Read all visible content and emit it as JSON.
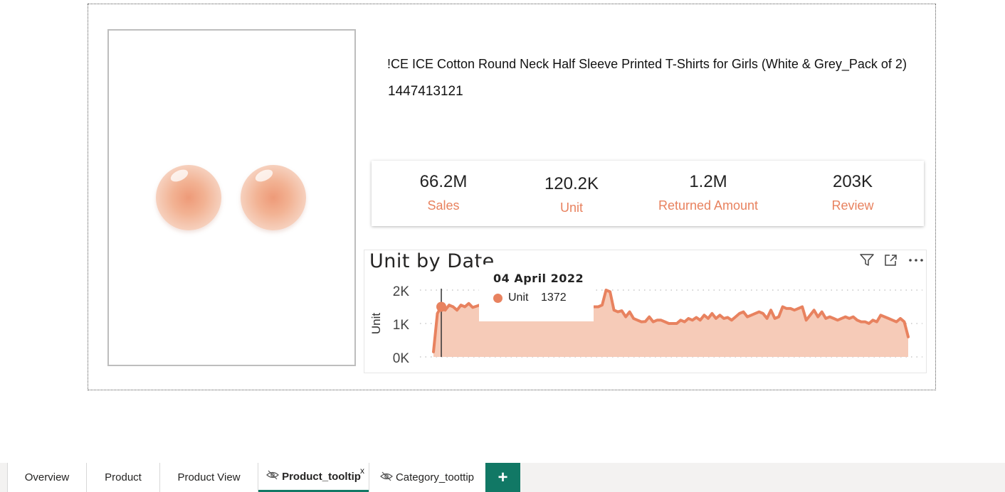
{
  "product": {
    "title": "!CE ICE Cotton Round Neck Half Sleeve Printed T-Shirts for Girls (White & Grey_Pack of 2)",
    "id": "1447413121"
  },
  "kpis": [
    {
      "value": "66.2M",
      "label": "Sales"
    },
    {
      "value": "120.2K",
      "label": "Unit"
    },
    {
      "value": "1.2M",
      "label": "Returned Amount"
    },
    {
      "value": "203K",
      "label": "Review"
    }
  ],
  "colors": {
    "accent": "#e8825f",
    "fill": "#f6cbb8",
    "tab_active": "#117865"
  },
  "chart_header": {
    "icons": [
      "filter-icon",
      "focus-mode-icon",
      "more-options-icon"
    ]
  },
  "tooltip": {
    "date": "04 April 2022",
    "series": "Unit",
    "value": "1372"
  },
  "chart_data": {
    "type": "area",
    "title": "Unit by Date",
    "ylabel": "Unit",
    "xlabel": "",
    "ylim": [
      0,
      2000
    ],
    "yticks": [
      "2K",
      "1K",
      "0K"
    ],
    "grid": true,
    "highlight_index": 2,
    "values": [
      150,
      1300,
      1500,
      1400,
      1550,
      1500,
      1400,
      1550,
      1500,
      1600,
      1480,
      1520,
      1560,
      1500,
      1550,
      1600,
      1500,
      1450,
      1550,
      1500,
      1480,
      1500,
      1450,
      1500,
      1550,
      1480,
      1500,
      1520,
      1500,
      1550,
      1520,
      1500,
      1600,
      1450,
      1500,
      1550,
      1500,
      1500,
      1550,
      1600,
      1500,
      1500,
      1500,
      1550,
      2000,
      1950,
      1400,
      1350,
      1380,
      1200,
      1350,
      1150,
      1100,
      1050,
      1060,
      1200,
      1050,
      1100,
      1100,
      1050,
      1000,
      1000,
      1000,
      1100,
      1050,
      1150,
      1100,
      1180,
      1100,
      1250,
      1150,
      1300,
      1150,
      1250,
      1150,
      1180,
      1100,
      1200,
      1300,
      1350,
      1200,
      1250,
      1300,
      1350,
      1300,
      1150,
      1400,
      1150,
      1200,
      1500,
      1450,
      1450,
      1400,
      1450,
      1500,
      1100,
      1250,
      1400,
      1200,
      1350,
      1150,
      1200,
      1150,
      1100,
      1150,
      1200,
      1150,
      1200,
      1100,
      1050,
      1050,
      1000,
      1100,
      1050,
      1250,
      1200,
      1150,
      1100,
      1050,
      1150,
      1050,
      600
    ]
  },
  "tabs": [
    {
      "label": "Overview"
    },
    {
      "label": "Product"
    },
    {
      "label": "Product View"
    },
    {
      "label": "Product_tooltip",
      "close": "x"
    },
    {
      "label": "Category_toottip"
    }
  ],
  "add_tab_label": "+"
}
